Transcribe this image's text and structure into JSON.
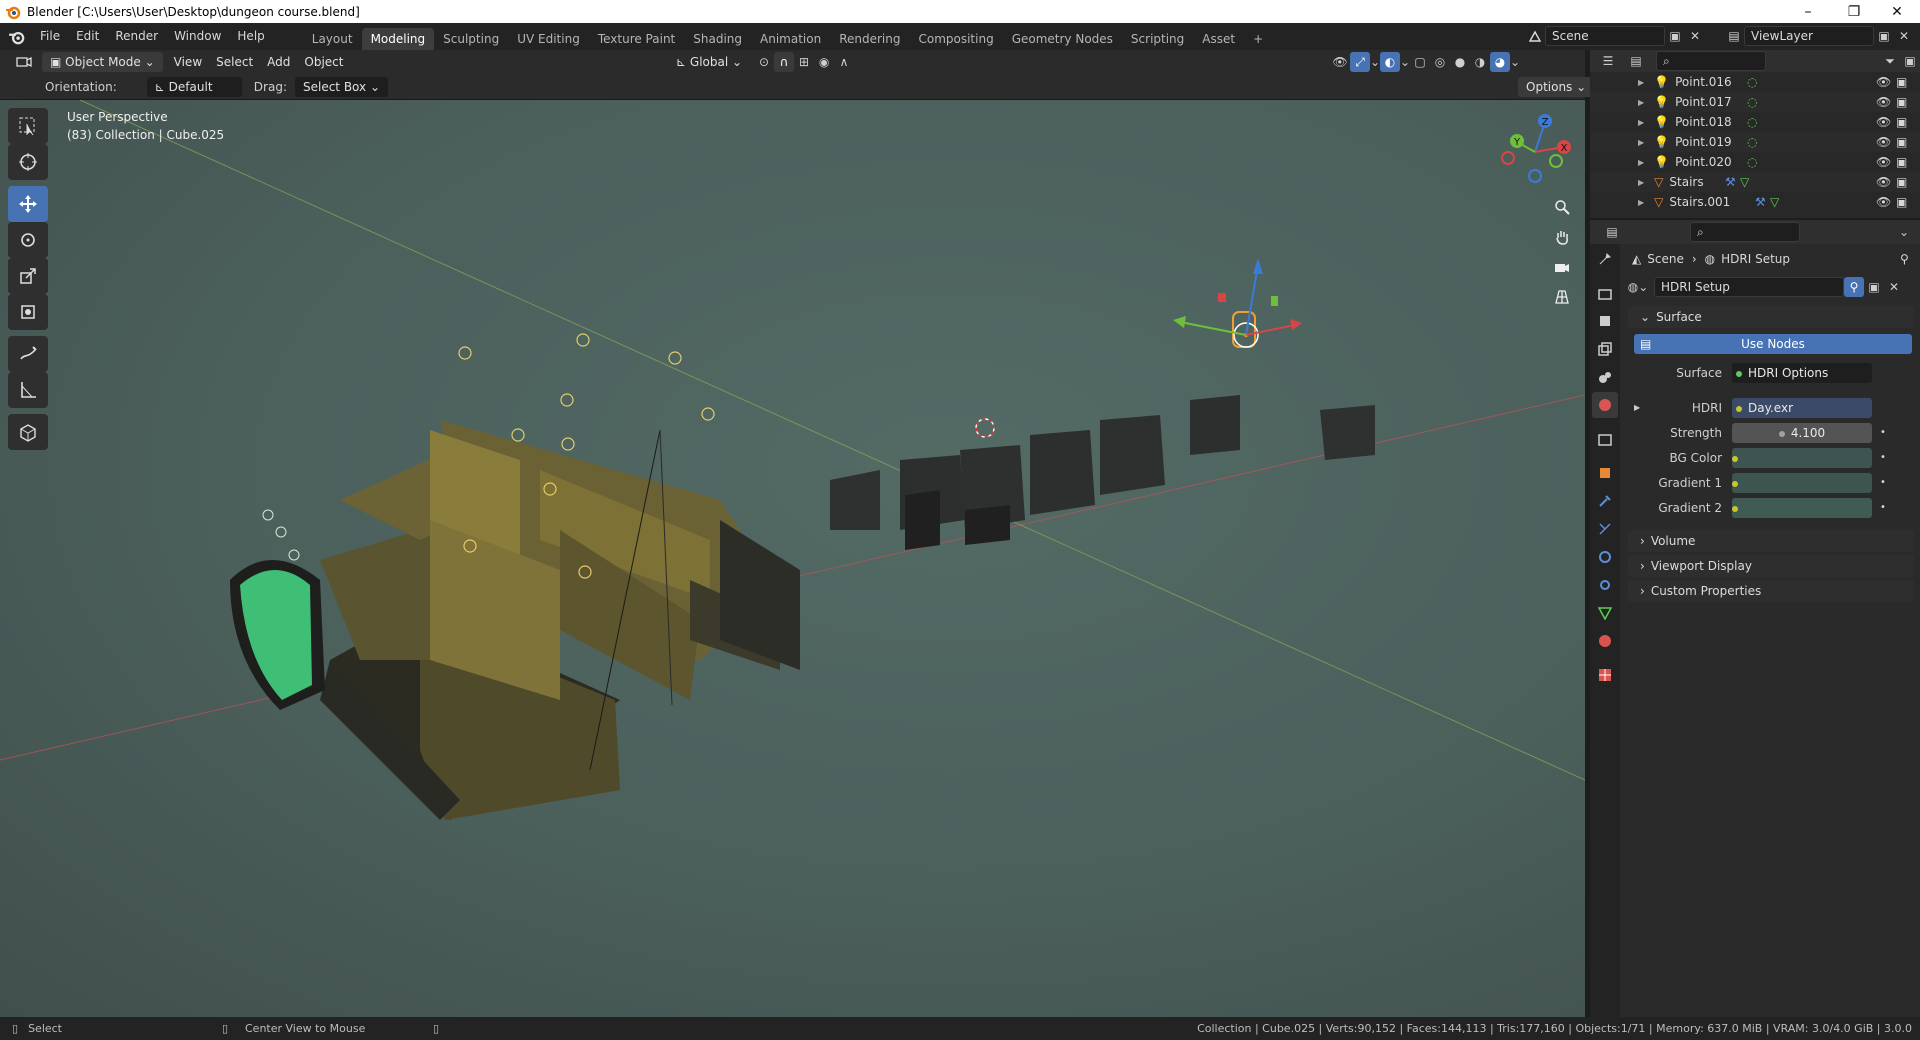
{
  "window": {
    "title": "Blender [C:\\Users\\User\\Desktop\\dungeon course.blend]",
    "minimize": "–",
    "maximize": "❐",
    "close": "✕"
  },
  "menu": [
    "File",
    "Edit",
    "Render",
    "Window",
    "Help"
  ],
  "workspaces": [
    "Layout",
    "Modeling",
    "Sculpting",
    "UV Editing",
    "Texture Paint",
    "Shading",
    "Animation",
    "Rendering",
    "Compositing",
    "Geometry Nodes",
    "Scripting",
    "Asset"
  ],
  "active_workspace": "Modeling",
  "add_workspace": "+",
  "scene": "Scene",
  "view_layer": "ViewLayer",
  "viewport_header": {
    "mode": "Object Mode",
    "menus": [
      "View",
      "Select",
      "Add",
      "Object"
    ],
    "transform_orientation": "Global"
  },
  "tool_settings": {
    "orientation_label": "Orientation:",
    "orientation_value": "Default",
    "drag_label": "Drag:",
    "drag_value": "Select Box",
    "options": "Options"
  },
  "viewport": {
    "view_name": "User Perspective",
    "context": "(83) Collection | Cube.025",
    "gizmo_axes": [
      "X",
      "Y",
      "Z"
    ]
  },
  "outliner": {
    "items": [
      {
        "name": "Point.016",
        "type": "light"
      },
      {
        "name": "Point.017",
        "type": "light"
      },
      {
        "name": "Point.018",
        "type": "light"
      },
      {
        "name": "Point.019",
        "type": "light"
      },
      {
        "name": "Point.020",
        "type": "light"
      },
      {
        "name": "Stairs",
        "type": "mesh"
      },
      {
        "name": "Stairs.001",
        "type": "mesh"
      }
    ]
  },
  "properties": {
    "breadcrumb": [
      "Scene",
      "HDRI Setup"
    ],
    "world_name": "HDRI Setup",
    "surface_panel": "Surface",
    "use_nodes": "Use Nodes",
    "rows": [
      {
        "label": "Surface",
        "value": "HDRI Options",
        "socket": "#63c763"
      },
      {
        "label": "HDRI",
        "value": "Day.exr",
        "socket": "#c7c729"
      },
      {
        "label": "Strength",
        "value": "4.100",
        "socket": "#a1a1a1"
      },
      {
        "label": "BG Color",
        "value": "",
        "socket": "#c7c729"
      },
      {
        "label": "Gradient 1",
        "value": "",
        "socket": "#c7c729"
      },
      {
        "label": "Gradient 2",
        "value": "",
        "socket": "#c7c729"
      }
    ],
    "collapsed_panels": [
      "Volume",
      "Viewport Display",
      "Custom Properties"
    ]
  },
  "colors": {
    "accent": "#4772b3",
    "bg_color_swatch": "#3e5450",
    "gradient1_swatch": "#3e5450",
    "gradient2_swatch": "#3f5b54",
    "hdri_field": "#3b4a66"
  },
  "statusbar": {
    "left_action": "Select",
    "mid_action": "Center View to Mouse",
    "stats": "Collection | Cube.025 | Verts:90,152 | Faces:144,113 | Tris:177,160 | Objects:1/71 | Memory: 637.0 MiB | VRAM: 3.0/4.0 GiB | 3.0.0"
  }
}
